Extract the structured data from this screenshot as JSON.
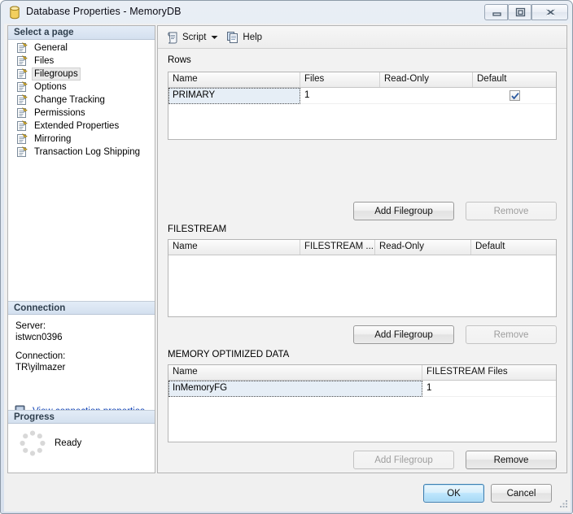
{
  "window": {
    "title": "Database Properties - MemoryDB",
    "icon": "database-icon",
    "minimize_label": "Minimize",
    "maximize_label": "Restore",
    "close_label": "Close"
  },
  "toolbar": {
    "script_label": "Script",
    "script_icon": "script-icon",
    "caret_icon": "chevron-down-icon",
    "help_label": "Help",
    "help_icon": "help-icon"
  },
  "sidebar": {
    "select_page_header": "Select a page",
    "items": [
      {
        "label": "General",
        "selected": false
      },
      {
        "label": "Files",
        "selected": false
      },
      {
        "label": "Filegroups",
        "selected": true
      },
      {
        "label": "Options",
        "selected": false
      },
      {
        "label": "Change Tracking",
        "selected": false
      },
      {
        "label": "Permissions",
        "selected": false
      },
      {
        "label": "Extended Properties",
        "selected": false
      },
      {
        "label": "Mirroring",
        "selected": false
      },
      {
        "label": "Transaction Log Shipping",
        "selected": false
      }
    ],
    "connection": {
      "header": "Connection",
      "server_label": "Server:",
      "server_value": "istwcn0396",
      "connection_label": "Connection:",
      "connection_value": "TR\\yilmazer",
      "link_label": "View connection properties",
      "link_icon": "server-connection-icon"
    },
    "progress": {
      "header": "Progress",
      "status": "Ready",
      "spinner_icon": "progress-spinner-icon"
    }
  },
  "main": {
    "rows_section": {
      "label": "Rows",
      "columns": [
        "Name",
        "Files",
        "Read-Only",
        "Default"
      ],
      "rows": [
        {
          "name": "PRIMARY",
          "files": "1",
          "read_only": "",
          "default": true,
          "selected": true
        }
      ],
      "add_button": {
        "label": "Add Filegroup",
        "disabled": false
      },
      "remove_button": {
        "label": "Remove",
        "disabled": true
      }
    },
    "filestream_section": {
      "label": "FILESTREAM",
      "columns": [
        "Name",
        "FILESTREAM ...",
        "Read-Only",
        "Default"
      ],
      "rows": [],
      "add_button": {
        "label": "Add Filegroup",
        "disabled": false
      },
      "remove_button": {
        "label": "Remove",
        "disabled": true
      }
    },
    "memory_section": {
      "label": "MEMORY OPTIMIZED DATA",
      "columns": [
        "Name",
        "FILESTREAM Files"
      ],
      "rows": [
        {
          "name": "InMemoryFG",
          "files": "1",
          "selected": true
        }
      ],
      "add_button": {
        "label": "Add Filegroup",
        "disabled": true
      },
      "remove_button": {
        "label": "Remove",
        "disabled": false
      }
    }
  },
  "footer": {
    "ok_label": "OK",
    "cancel_label": "Cancel",
    "grip_icon": "resize-grip-icon"
  },
  "colors": {
    "accent": "#3c7fb1",
    "link": "#0b3fb5",
    "selection": "#e6eef6",
    "panel": "#f2f2f2",
    "header_bar": "#d4e0ef"
  }
}
